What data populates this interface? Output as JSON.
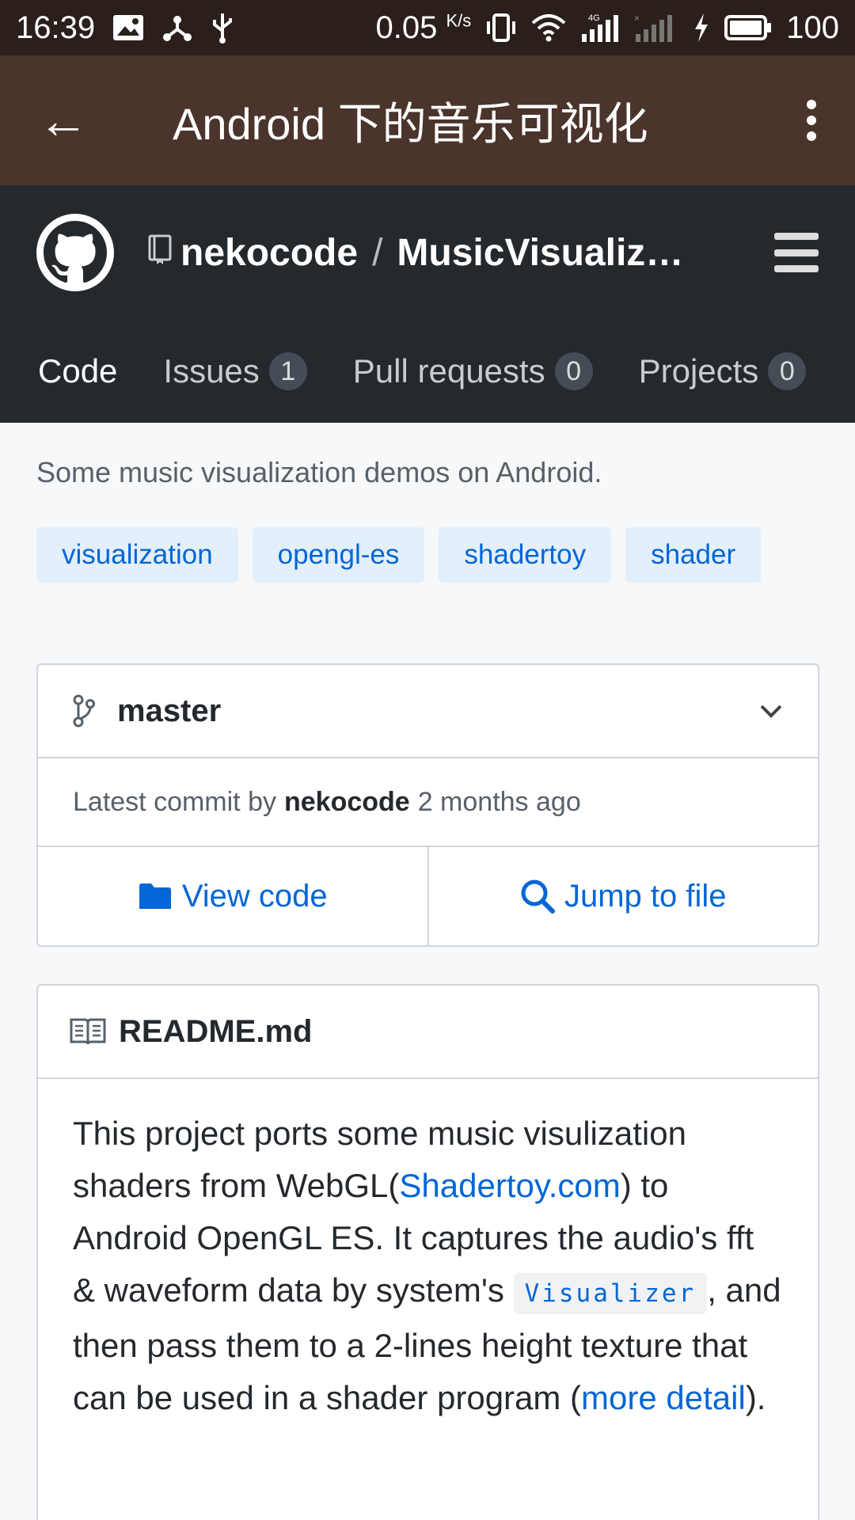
{
  "status_bar": {
    "time": "16:39",
    "net_speed": "0.05",
    "net_speed_unit": "K/s",
    "battery": "100",
    "network_type": "4G"
  },
  "app_bar": {
    "back_icon": "←",
    "title": "Android 下的音乐可视化"
  },
  "repo": {
    "owner": "nekocode",
    "separator": "/",
    "name": "MusicVisualizati…"
  },
  "tabs": [
    {
      "label": "Code",
      "count": null,
      "active": true
    },
    {
      "label": "Issues",
      "count": "1"
    },
    {
      "label": "Pull requests",
      "count": "0"
    },
    {
      "label": "Projects",
      "count": "0"
    }
  ],
  "description": "Some music visualization demos on Android.",
  "topics": [
    "visualization",
    "opengl-es",
    "shadertoy",
    "shader"
  ],
  "branch": {
    "name": "master",
    "commit_prefix": "Latest commit by",
    "commit_author": "nekocode",
    "commit_time": "2 months ago",
    "view_code_label": "View code",
    "jump_label": "Jump to file"
  },
  "readme": {
    "title": "README.md",
    "p1": "This project ports some music visulization shaders from WebGL(",
    "link1": "Shadertoy.com",
    "p2": ") to Android OpenGL ES. It captures the audio's fft & waveform data by system's ",
    "code": "Visualizer",
    "p3": ", and then pass them to a 2-lines height texture that can be used in a shader program (",
    "link2": "more detail",
    "p4": ")."
  },
  "colors": {
    "status_bar_bg": "#2a1f1b",
    "app_bar_bg": "#4a342c",
    "gh_header_bg": "#24292e",
    "link": "#0366d6",
    "topic_bg": "#e3effb"
  }
}
